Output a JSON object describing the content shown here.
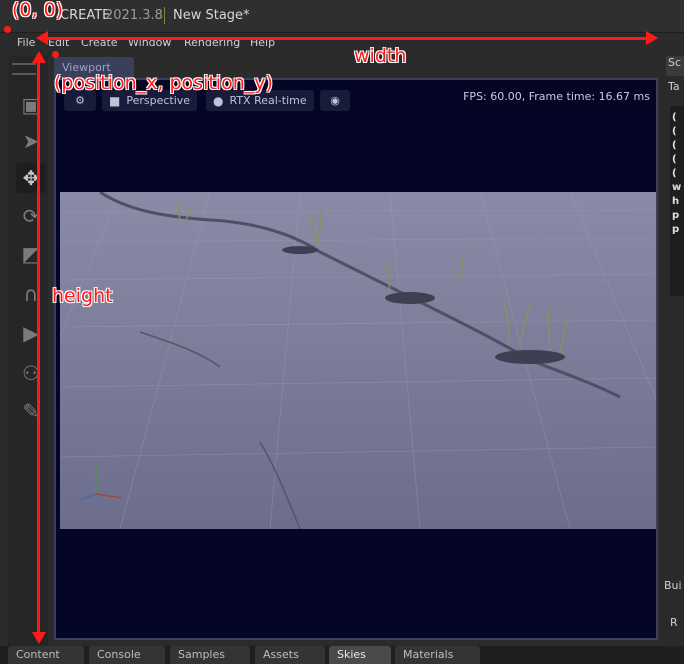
{
  "window": {
    "app_name": "CREATE",
    "app_version": "2021.3.8",
    "stage_title": "New Stage*"
  },
  "menu": [
    "File",
    "Edit",
    "Create",
    "Window",
    "Rendering",
    "Help"
  ],
  "toolbar_icons": [
    "select-icon",
    "pointer-icon",
    "move-icon",
    "rotate-icon",
    "scale-icon",
    "snap-icon",
    "play-icon",
    "physics-icon",
    "paint-icon"
  ],
  "viewport": {
    "tab_label": "Viewport",
    "camera_label": "Perspective",
    "render_mode_label": "RTX Real-time",
    "fps_text": "FPS: 60.00, Frame time: 16.67 ms"
  },
  "right_panel": {
    "tab_label": "Sc",
    "text": "Ta",
    "lines": [
      "(",
      "(",
      "(",
      "(",
      "(",
      "w",
      "h",
      "p",
      "p"
    ],
    "lower_labels": [
      "Bui",
      "R"
    ]
  },
  "bottom_tabs": [
    "Content",
    "Console",
    "Samples",
    "Assets",
    "Skies",
    "Materials"
  ],
  "active_bottom_tab": "Skies",
  "annotations": {
    "origin": "(0, 0)",
    "position": "(position_x, position_y)",
    "width": "width",
    "height": "height"
  },
  "colors": {
    "annotation": "#ff1a1a",
    "viewport_bg": "#050526",
    "accent_separator": "#7a8a3a"
  }
}
